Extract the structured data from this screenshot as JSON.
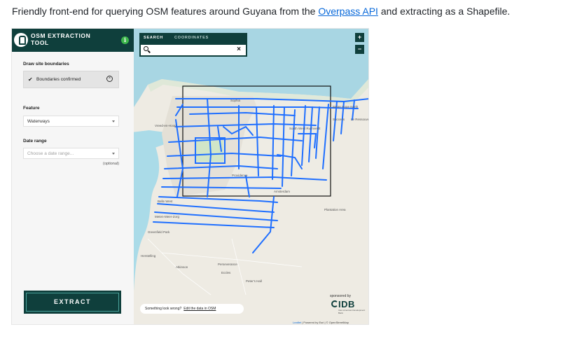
{
  "caption": {
    "before": "Friendly front-end for querying OSM features around Guyana from the ",
    "link": "Overpass API",
    "after": " and extracting as a Shapefile."
  },
  "sidebar": {
    "title": "OSM EXTRACTION TOOL",
    "info_icon": "i",
    "draw_label": "Draw site boundaries",
    "boundary_status": "Boundaries confirmed",
    "boundary_check": "✔",
    "boundary_clear": "×",
    "feature_label": "Feature",
    "feature_value": "Waterways",
    "date_label": "Date range",
    "date_placeholder": "Choose a date range...",
    "optional_note": "(optional)",
    "extract_label": "EXTRACT"
  },
  "map": {
    "search_tab": "SEARCH",
    "coords_tab": "COORDINATES",
    "search_value": "",
    "clear_icon": "×",
    "zoom_in": "+",
    "zoom_out": "−",
    "feedback_text": "Something look wrong?",
    "feedback_link": "Edit the data in OSM",
    "sponsored_by": "sponsored by",
    "sponsor_name": "IDB",
    "sponsor_sub": "Inter-American Development Bank",
    "attribution_leaflet": "Leaflet",
    "attribution_rest": " | Powered by Esri | © OpenStreetMap",
    "place_labels": [
      "Sophia",
      "Better Hope North",
      "Success",
      "Le Ressouvenir",
      "South West Ruimveldt",
      "Providence",
      "Atkinson",
      "Herstelling",
      "Perseverance",
      "Eccles",
      "Plantation Area",
      "Peter's Hall",
      "Vreed-en-Hoop",
      "Greenfield Park",
      "Meten-Meer-Zorg",
      "Belle West",
      "Amsterdam"
    ],
    "colors": {
      "sea": "#a8d6e3",
      "land": "#eeebe3",
      "water_line": "#1f6fff",
      "river": "#aadbe8",
      "selection": "#111111"
    }
  }
}
